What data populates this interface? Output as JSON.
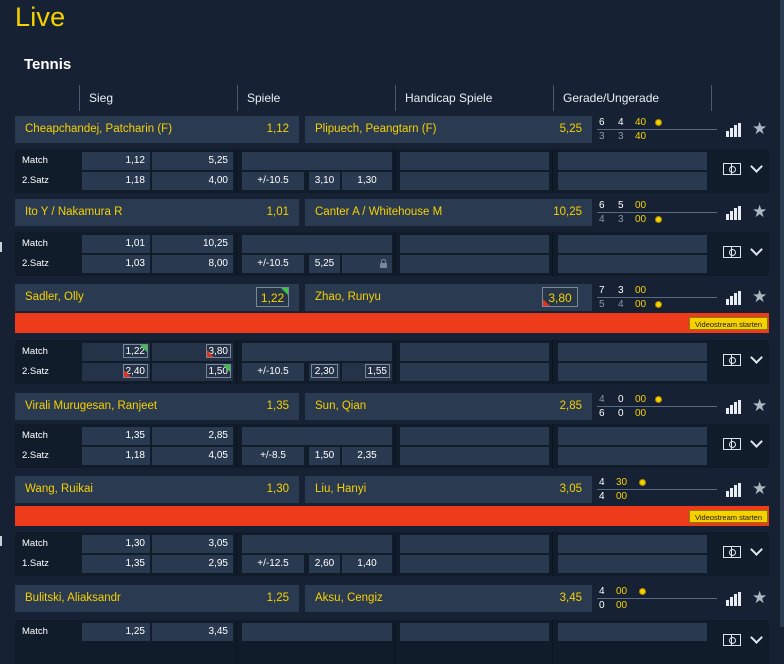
{
  "page": {
    "title": "Live",
    "sport": "Tennis"
  },
  "columns": [
    "Sieg",
    "Spiele",
    "Handicap Spiele",
    "Gerade/Ungerade"
  ],
  "colors": {
    "accent": "#f6d100",
    "background": "#162233",
    "stream_bar": "#ee3b1b"
  },
  "stream_label": "Videostream starten",
  "matches": [
    {
      "p1": "Cheapchandej, Patcharin (F)",
      "o1": "1,12",
      "p2": "Plipuech, Peangtarn (F)",
      "o2": "5,25",
      "score": [
        [
          "6",
          "4",
          "40"
        ],
        [
          "3",
          "3",
          "40"
        ]
      ],
      "serve": 0,
      "rows": [
        {
          "label": "Match",
          "w1": "1,12",
          "w2": "5,25"
        },
        {
          "label": "2.Satz",
          "w1": "1,18",
          "w2": "4,00",
          "h": "+/-10.5",
          "h1": "3,10",
          "h2": "1,30"
        }
      ]
    },
    {
      "p1": "Ito Y / Nakamura R",
      "o1": "1,01",
      "p2": "Canter A / Whitehouse M",
      "o2": "10,25",
      "score": [
        [
          "6",
          "5",
          "00"
        ],
        [
          "4",
          "3",
          "00"
        ]
      ],
      "serve": 1,
      "rows": [
        {
          "label": "Match",
          "w1": "1,01",
          "w2": "10,25"
        },
        {
          "label": "2.Satz",
          "w1": "1,03",
          "w2": "8,00",
          "h": "+/-10.5",
          "h1": "5,25",
          "h2": ""
        }
      ]
    },
    {
      "p1": "Sadler, Olly",
      "o1": "1,22",
      "p2": "Zhao, Runyu",
      "o2": "3,80",
      "score": [
        [
          "7",
          "3",
          "00"
        ],
        [
          "5",
          "4",
          "00"
        ]
      ],
      "serve": 1,
      "rows": [
        {
          "label": "Match",
          "w1": "1,22",
          "w2": "3,80"
        },
        {
          "label": "2.Satz",
          "w1": "2,40",
          "w2": "1,50",
          "h": "+/-10.5",
          "h1": "2,30",
          "h2": "1,55"
        }
      ]
    },
    {
      "p1": "Virali Murugesan, Ranjeet",
      "o1": "1,35",
      "p2": "Sun, Qian",
      "o2": "2,85",
      "score": [
        [
          "4",
          "0",
          "00"
        ],
        [
          "6",
          "0",
          "00"
        ]
      ],
      "serve": 0,
      "rows": [
        {
          "label": "Match",
          "w1": "1,35",
          "w2": "2,85"
        },
        {
          "label": "2.Satz",
          "w1": "1,18",
          "w2": "4,05",
          "h": "+/-8.5",
          "h1": "1,50",
          "h2": "2,35"
        }
      ]
    },
    {
      "p1": "Wang, Ruikai",
      "o1": "1,30",
      "p2": "Liu, Hanyi",
      "o2": "3,05",
      "score": [
        [
          "4",
          "30"
        ],
        [
          "4",
          "00"
        ]
      ],
      "serve": 0,
      "rows": [
        {
          "label": "Match",
          "w1": "1,30",
          "w2": "3,05"
        },
        {
          "label": "1.Satz",
          "w1": "1,35",
          "w2": "2,95",
          "h": "+/-12.5",
          "h1": "2,60",
          "h2": "1,40"
        }
      ]
    },
    {
      "p1": "Bulitski, Aliaksandr",
      "o1": "1,25",
      "p2": "Aksu, Cengiz",
      "o2": "3,45",
      "score": [
        [
          "4",
          "00"
        ],
        [
          "0",
          "00"
        ]
      ],
      "serve": 0,
      "rows": [
        {
          "label": "Match",
          "w1": "1,25",
          "w2": "3,45"
        }
      ]
    }
  ]
}
